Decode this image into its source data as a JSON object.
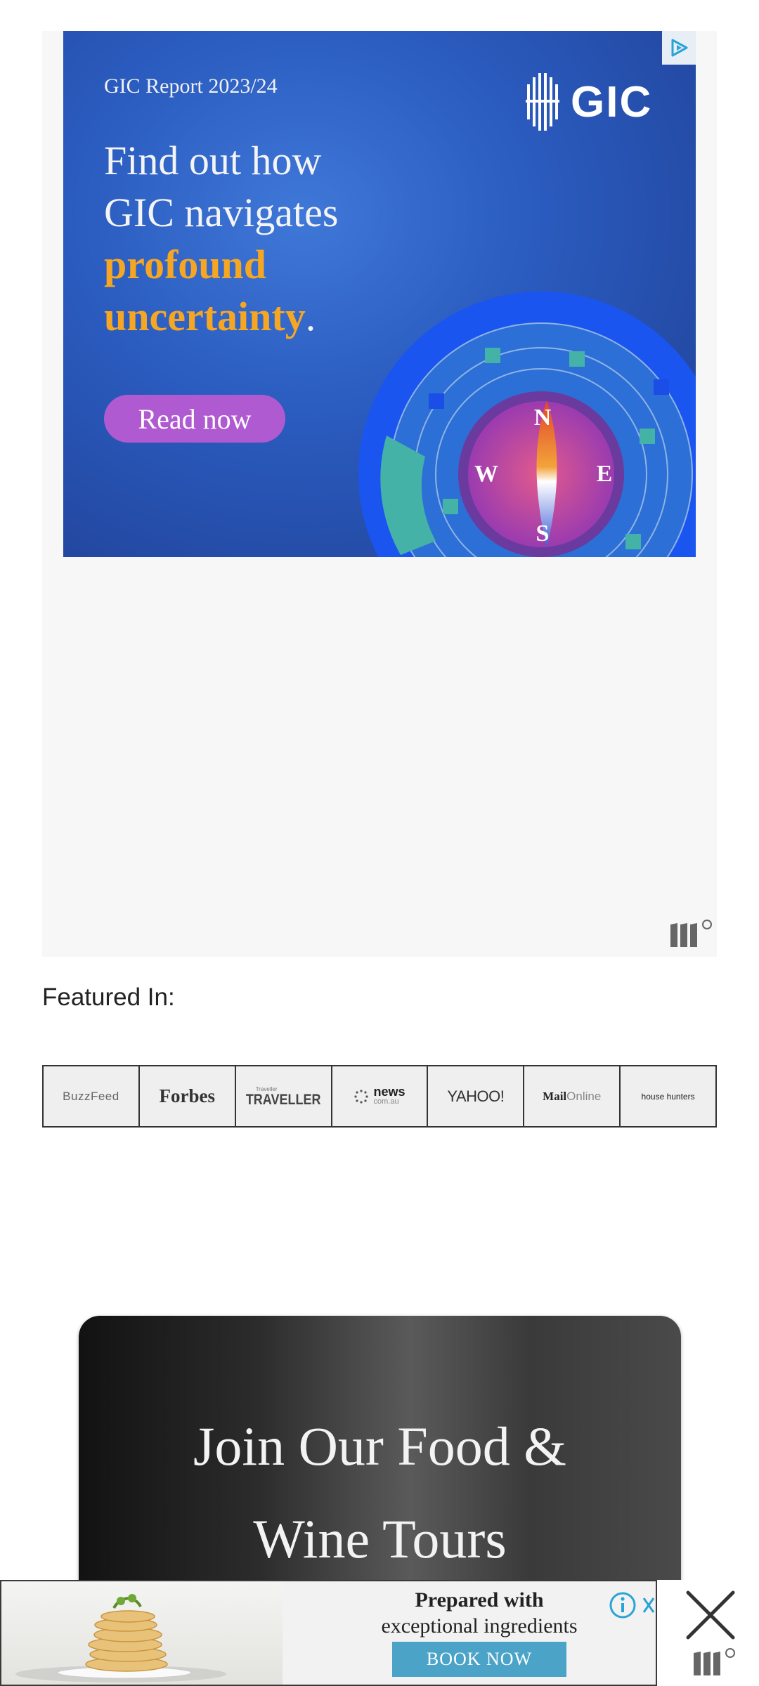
{
  "top_ad": {
    "report_label": "GIC Report 2023/24",
    "brand": "GIC",
    "headline_line1": "Find out how",
    "headline_line2": "GIC navigates",
    "headline_highlight1": "profound",
    "headline_highlight2": "uncertainty",
    "headline_period": ".",
    "cta_label": "Read now",
    "compass_n": "N",
    "compass_s": "S",
    "compass_e": "E",
    "compass_w": "W",
    "adchoices_icon": "adchoices-icon",
    "colors": {
      "bg": "#2b5cc0",
      "highlight": "#f5a623",
      "cta": "#b05ad1"
    }
  },
  "featured": {
    "label": "Featured In:",
    "logos": [
      "BuzzFeed",
      "Forbes",
      "TRAVELLER",
      "news",
      "YAHOO!",
      "Mail",
      "house hunters"
    ],
    "news_sub": "com.au",
    "mail_sub": "Online",
    "traveller_sub": "Traveller"
  },
  "tours_card": {
    "title_line1": "Join Our Food &",
    "title_line2": "Wine Tours"
  },
  "bottom_ad": {
    "line1": "Prepared with",
    "line2": "exceptional ingredients",
    "cta_label": "BOOK NOW",
    "info_icon": "info-icon",
    "close_icon": "close-icon",
    "colors": {
      "cta": "#4ba3c7"
    }
  }
}
